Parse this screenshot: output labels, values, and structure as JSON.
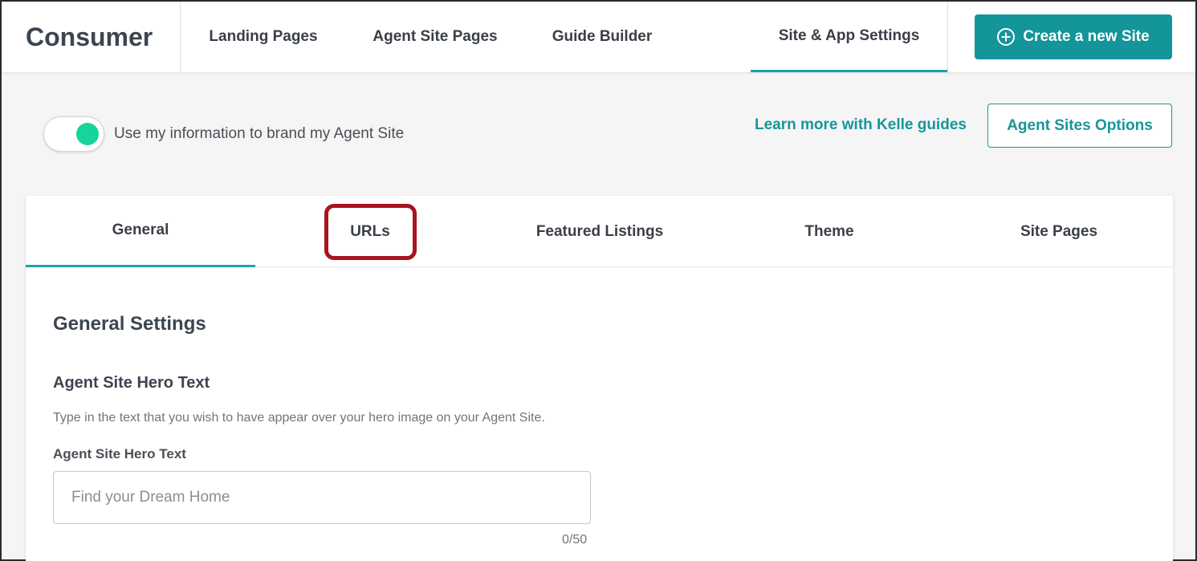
{
  "header": {
    "brand": "Consumer",
    "nav": [
      "Landing Pages",
      "Agent Site Pages",
      "Guide Builder",
      "Site & App Settings"
    ],
    "active_nav": "Site & App Settings",
    "create_button": "Create a new Site"
  },
  "branding": {
    "toggle_label": "Use my information to brand my Agent Site",
    "toggle_on": true,
    "learn_link": "Learn more with Kelle guides",
    "options_button": "Agent Sites Options"
  },
  "tabs": [
    "General",
    "URLs",
    "Featured Listings",
    "Theme",
    "Site Pages"
  ],
  "active_tab": "General",
  "highlighted_tab": "URLs",
  "general": {
    "section_title": "General Settings",
    "hero_title": "Agent Site Hero Text",
    "hero_helper": "Type in the text that you wish to have appear over your hero image on your Agent Site.",
    "hero_label": "Agent Site Hero Text",
    "hero_placeholder": "Find your Dream Home",
    "hero_value": "",
    "char_count": "0/50"
  },
  "colors": {
    "accent": "#17969b",
    "button_fill": "#13959a",
    "toggle_on": "#17d39c",
    "highlight": "#a8141d"
  },
  "icons": {
    "create_button_icon": "plus-circle-icon"
  }
}
